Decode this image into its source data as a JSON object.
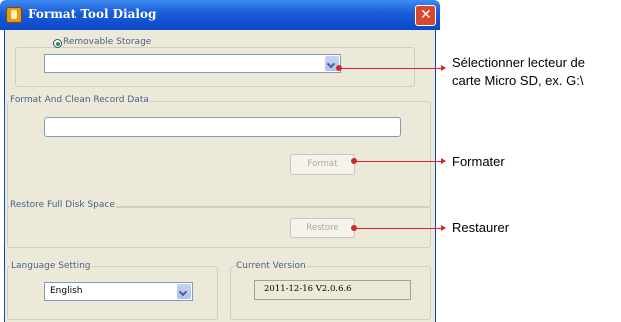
{
  "window": {
    "title": "Format Tool Dialog"
  },
  "storage": {
    "radio_label": "Removable Storage",
    "selected_drive": ""
  },
  "format_section": {
    "legend": "Format And Clean Record Data",
    "record_text": "",
    "format_button": "Format"
  },
  "restore_section": {
    "legend": "Restore Full Disk Space",
    "restore_button": "Restore"
  },
  "language": {
    "legend": "Language Setting",
    "selected": "English"
  },
  "version": {
    "legend": "Current Version",
    "value": "2011-12-16 V2.0.6.6"
  },
  "annotations": {
    "select_line1": "Sélectionner lecteur de",
    "select_line2": "carte  Micro SD, ex. G:\\",
    "format": "Formater",
    "restore": "Restaurer"
  },
  "colors": {
    "accent_red": "#d4262b",
    "titlebar_blue": "#0a47c8",
    "dialog_bg": "#ece9d8"
  }
}
